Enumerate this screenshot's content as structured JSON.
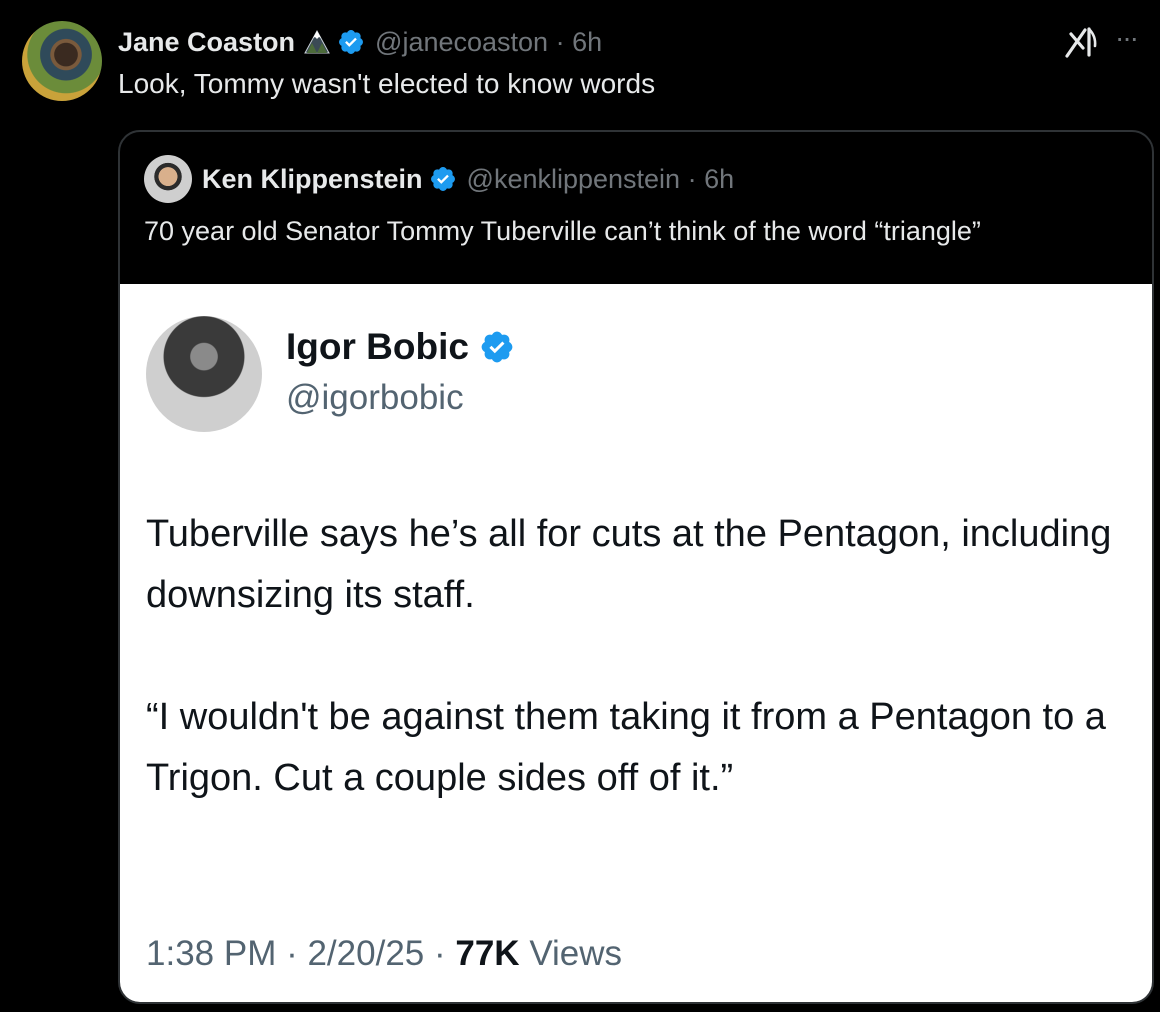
{
  "tweet": {
    "author_name": "Jane Coaston",
    "author_handle": "@janecoaston",
    "time_sep": " · ",
    "time": "6h",
    "text": "Look, Tommy wasn't elected to know words",
    "more_label": "···"
  },
  "quoted": {
    "author_name": "Ken Klippenstein",
    "author_handle": "@kenklippenstein",
    "time_sep": " · ",
    "time": "6h",
    "text": "70 year old Senator Tommy Tuberville can’t think of the word “triangle”"
  },
  "screenshot": {
    "author_name": "Igor Bobic",
    "author_handle": "@igorbobic",
    "paragraph1": "Tuberville says he’s all for cuts at the Pentagon, including downsizing its staff.",
    "paragraph2": "“I wouldn't be against them taking it from a Pentagon to a Trigon. Cut a couple sides off of it.”",
    "time": "1:38 PM",
    "date": "2/20/25",
    "sep": " · ",
    "views_count": "77K",
    "views_label": "Views"
  },
  "colors": {
    "background": "#000000",
    "verified_blue": "#1d9bf0",
    "muted_text": "#71767b",
    "border": "#2f3336"
  },
  "icons": {
    "verified": "verified-badge-icon",
    "grok": "grok-icon",
    "more": "more-icon",
    "mountain": "mountain-emoji-icon"
  }
}
